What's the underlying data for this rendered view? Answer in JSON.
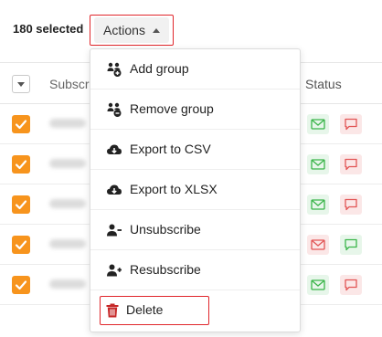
{
  "toolbar": {
    "selected_text": "180 selected",
    "actions_label": "Actions"
  },
  "table": {
    "columns": {
      "subscriber": "Subscri",
      "status": "Status"
    },
    "rows": [
      {
        "checked": true,
        "status_email": "green",
        "status_sms": "red"
      },
      {
        "checked": true,
        "status_email": "green",
        "status_sms": "red"
      },
      {
        "checked": true,
        "status_email": "green",
        "status_sms": "red"
      },
      {
        "checked": true,
        "status_email": "red",
        "status_sms": "green"
      },
      {
        "checked": true,
        "status_email": "green",
        "status_sms": "red"
      }
    ]
  },
  "menu": {
    "items": [
      {
        "label": "Add group",
        "icon": "add-group-icon"
      },
      {
        "label": "Remove group",
        "icon": "remove-group-icon"
      },
      {
        "label": "Export to CSV",
        "icon": "cloud-download-icon"
      },
      {
        "label": "Export to XLSX",
        "icon": "cloud-download-icon"
      },
      {
        "label": "Unsubscribe",
        "icon": "user-minus-icon"
      },
      {
        "label": "Resubscribe",
        "icon": "user-plus-icon"
      },
      {
        "label": "Delete",
        "icon": "trash-icon"
      }
    ]
  },
  "colors": {
    "accent_orange": "#f7941d",
    "highlight_red": "#e0262b",
    "delete_red": "#c62828",
    "status_green": "#3bb54a",
    "status_red": "#e25555"
  }
}
